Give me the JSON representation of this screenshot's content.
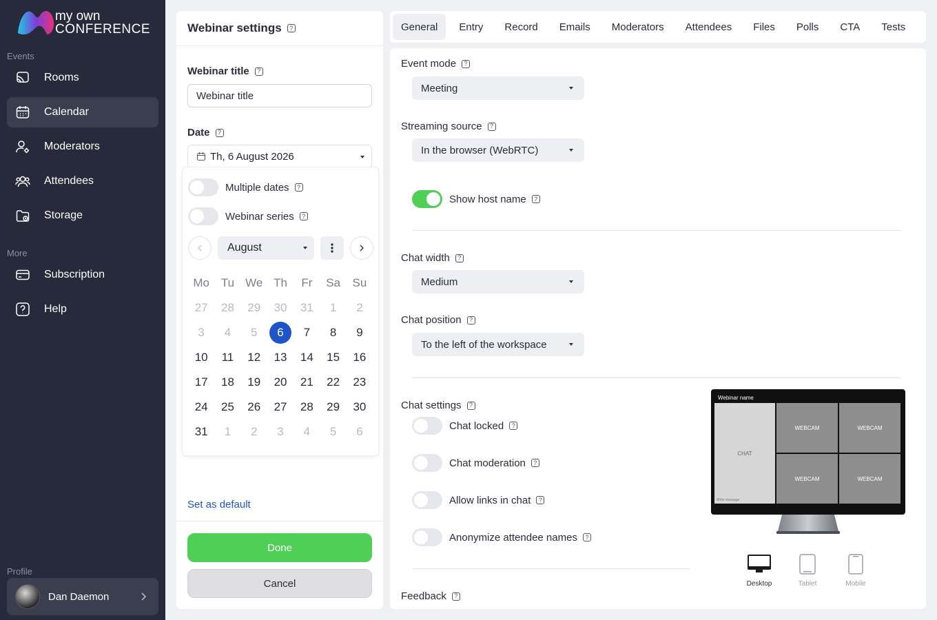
{
  "logo": {
    "line1": "my own",
    "line2": "CONFERENCE"
  },
  "sidebar": {
    "section_events": "Events",
    "section_more": "More",
    "section_profile": "Profile",
    "items": [
      {
        "label": "Rooms",
        "icon": "cast-icon"
      },
      {
        "label": "Calendar",
        "icon": "calendar-icon",
        "active": true
      },
      {
        "label": "Moderators",
        "icon": "user-gear-icon"
      },
      {
        "label": "Attendees",
        "icon": "users-icon"
      },
      {
        "label": "Storage",
        "icon": "folder-icon"
      }
    ],
    "more_items": [
      {
        "label": "Subscription",
        "icon": "card-icon"
      },
      {
        "label": "Help",
        "icon": "help-icon"
      }
    ],
    "profile_name": "Dan Daemon"
  },
  "webinar": {
    "header": "Webinar settings",
    "title_label": "Webinar title",
    "title_value": "Webinar title",
    "date_label": "Date",
    "date_value": "Th, 6 August 2026",
    "multiple_dates": "Multiple dates",
    "webinar_series": "Webinar series",
    "month": "August",
    "weekdays": [
      "Mo",
      "Tu",
      "We",
      "Th",
      "Fr",
      "Sa",
      "Su"
    ],
    "weeks": [
      [
        "27",
        "28",
        "29",
        "30",
        "31",
        "1",
        "2"
      ],
      [
        "3",
        "4",
        "5",
        "6",
        "7",
        "8",
        "9"
      ],
      [
        "10",
        "11",
        "12",
        "13",
        "14",
        "15",
        "16"
      ],
      [
        "17",
        "18",
        "19",
        "20",
        "21",
        "22",
        "23"
      ],
      [
        "24",
        "25",
        "26",
        "27",
        "28",
        "29",
        "30"
      ],
      [
        "31",
        "1",
        "2",
        "3",
        "4",
        "5",
        "6"
      ]
    ],
    "selected_day": "6",
    "set_default": "Set as default",
    "done": "Done",
    "cancel": "Cancel"
  },
  "tabs": [
    "General",
    "Entry",
    "Record",
    "Emails",
    "Moderators",
    "Attendees",
    "Files",
    "Polls",
    "CTA",
    "Tests"
  ],
  "settings": {
    "event_mode_label": "Event mode",
    "event_mode_value": "Meeting",
    "streaming_label": "Streaming source",
    "streaming_value": "In the browser (WebRTC)",
    "show_host_name": "Show host name",
    "chat_width_label": "Chat width",
    "chat_width_value": "Medium",
    "chat_position_label": "Chat position",
    "chat_position_value": "To the left of the workspace",
    "chat_settings_label": "Chat settings",
    "chat_locked": "Chat locked",
    "chat_moderation": "Chat moderation",
    "allow_links": "Allow links in chat",
    "anonymize": "Anonymize attendee names",
    "feedback_label": "Feedback"
  },
  "preview": {
    "title": "Webinar name",
    "chat": "CHAT",
    "write": "Write message",
    "webcam": "WEBCAM",
    "devices": [
      "Desktop",
      "Tablet",
      "Mobile"
    ]
  },
  "colors": {
    "sidebar": "#262a3a",
    "accent_green": "#4fcf55",
    "accent_blue": "#1f54c8"
  }
}
